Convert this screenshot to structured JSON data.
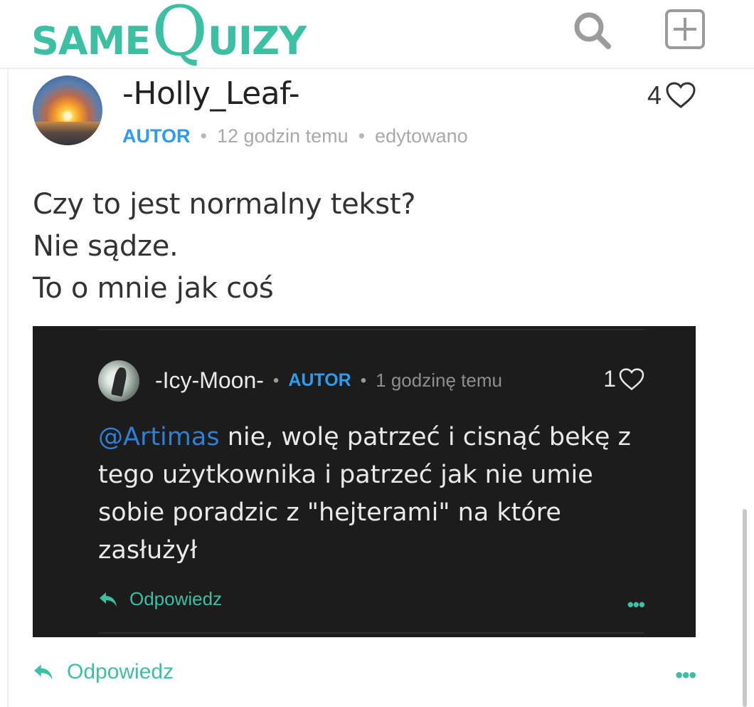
{
  "header": {
    "logo_same": "SAME",
    "logo_q": "Q",
    "logo_rest": "UIZY",
    "search_icon": "search-icon",
    "add_icon": "add-square-icon",
    "brand_color": "#3dbfa3"
  },
  "comment": {
    "username": "-Holly_Leaf-",
    "role": "AUTOR",
    "time": "12 godzin temu",
    "edited": "edytowano",
    "likes": "4",
    "lines": [
      "Czy to jest normalny tekst?",
      "Nie sądze.",
      "To o mnie jak coś"
    ],
    "reply_label": "Odpowiedz",
    "more_label": "•••"
  },
  "reply": {
    "username": "-Icy-Moon-",
    "role": "AUTOR",
    "time": "1 godzinę temu",
    "likes": "1",
    "mention": "@Artimas",
    "text": " nie, wolę patrzeć i cisnąć bekę z tego użytkownika i patrzeć jak nie umie sobie poradzic z \"hejterami\" na które zasłużył",
    "reply_label": "Odpowiedz",
    "more_label": "•••",
    "link_color": "#2f7fd6",
    "role_color": "#2d9cf0"
  }
}
